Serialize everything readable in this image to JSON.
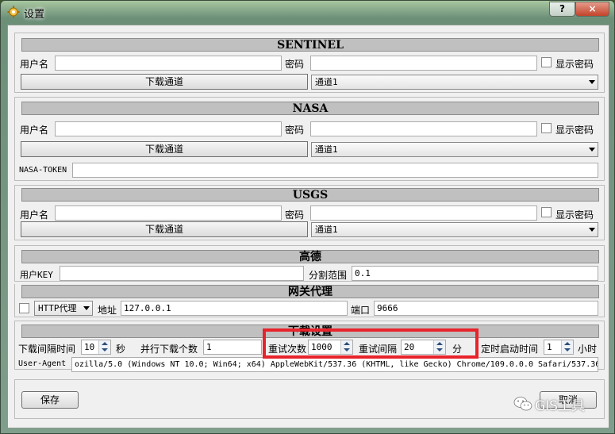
{
  "window": {
    "title": "设置",
    "help_label": "?",
    "close_label": "×"
  },
  "sentinel": {
    "header": "SENTINEL",
    "username_label": "用户名",
    "username_value": "",
    "password_label": "密码",
    "password_value": "",
    "show_password_label": "显示密码",
    "download_channel_button": "下载通道",
    "channel_value": "通道1"
  },
  "nasa": {
    "header": "NASA",
    "username_label": "用户名",
    "username_value": "",
    "password_label": "密码",
    "password_value": "",
    "show_password_label": "显示密码",
    "download_channel_button": "下载通道",
    "channel_value": "通道1",
    "token_label": "NASA-TOKEN",
    "token_value": ""
  },
  "usgs": {
    "header": "USGS",
    "username_label": "用户名",
    "username_value": "",
    "password_label": "密码",
    "password_value": "",
    "show_password_label": "显示密码",
    "download_channel_button": "下载通道",
    "channel_value": "通道1"
  },
  "gaode": {
    "header": "高德",
    "user_key_label": "用户KEY",
    "user_key_value": "",
    "split_range_label": "分割范围",
    "split_range_value": "0.1"
  },
  "proxy": {
    "header": "网关代理",
    "proxy_type": "HTTP代理",
    "address_label": "地址",
    "address_value": "127.0.0.1",
    "port_label": "端口",
    "port_value": "9666"
  },
  "download": {
    "header": "下载设置",
    "interval_label": "下载间隔时间",
    "interval_value": "10",
    "interval_unit": "秒",
    "parallel_label": "并行下载个数",
    "parallel_value": "1",
    "retry_count_label": "重试次数",
    "retry_count_value": "1000",
    "retry_interval_label": "重试间隔",
    "retry_interval_value": "20",
    "retry_interval_unit": "分",
    "scheduled_label": "定时启动时间",
    "scheduled_value": "1",
    "scheduled_unit": "小时",
    "user_agent_label": "User-Agent",
    "user_agent_value": "ozilla/5.0 (Windows NT 10.0; Win64; x64) AppleWebKit/537.36 (KHTML, like Gecko) Chrome/109.0.0.0 Safari/537.36"
  },
  "footer": {
    "save_button": "保存",
    "cancel_button": "取消"
  },
  "watermark": {
    "text": "GIS工具"
  },
  "colors": {
    "highlight_box": "#e8232a"
  }
}
